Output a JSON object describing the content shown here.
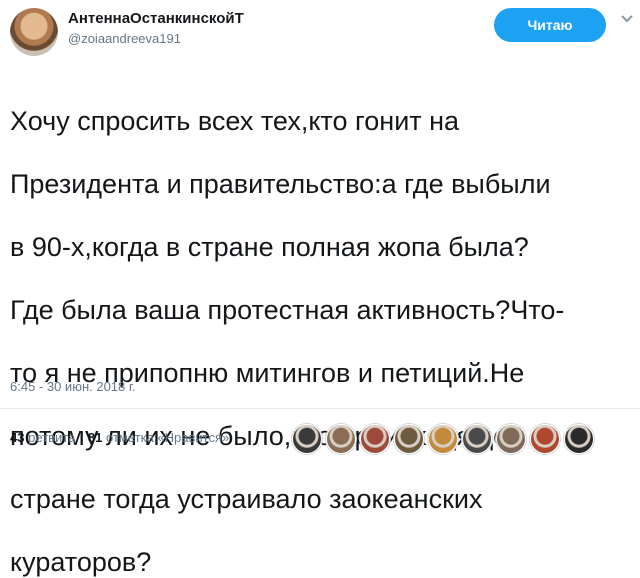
{
  "author": {
    "display_name": "АнтеннаОстанкинскойТ",
    "handle": "@zoiaandreeva191",
    "avatar_icon": "user-avatar"
  },
  "follow_button": {
    "label": "Читаю",
    "color": "#1da1f2"
  },
  "tweet": {
    "lines": [
      "Хочу спросить всех тех,кто гонит на",
      "Президента и правительство:а где выбыли",
      "в 90-х,когда в стране полная жопа была?",
      "Где была ваша протестная активность?Что-",
      "то я не припопню митингов и петиций.Не",
      "потому ли их не было,что происходящее в",
      "стране тогда устраивало заокеанских",
      "кураторов?"
    ],
    "timestamp": "6:45 - 30 июн. 2018 г."
  },
  "stats": {
    "retweets_count": "43",
    "retweets_label": "ретвита",
    "likes_count": "81",
    "likes_label": "отметка «Нравится»"
  },
  "likers": [
    {
      "name": "liker-avatar-1",
      "color": "#3a3a3a"
    },
    {
      "name": "liker-avatar-2",
      "color": "#8a6d55"
    },
    {
      "name": "liker-avatar-3",
      "color": "#a04a3c"
    },
    {
      "name": "liker-avatar-4",
      "color": "#6e5b3e"
    },
    {
      "name": "liker-avatar-5",
      "color": "#c28a3a"
    },
    {
      "name": "liker-avatar-6",
      "color": "#4a4a4a"
    },
    {
      "name": "liker-avatar-7",
      "color": "#7d6a58"
    },
    {
      "name": "liker-avatar-8",
      "color": "#b0472f"
    },
    {
      "name": "liker-avatar-9",
      "color": "#2b2b2b"
    }
  ]
}
